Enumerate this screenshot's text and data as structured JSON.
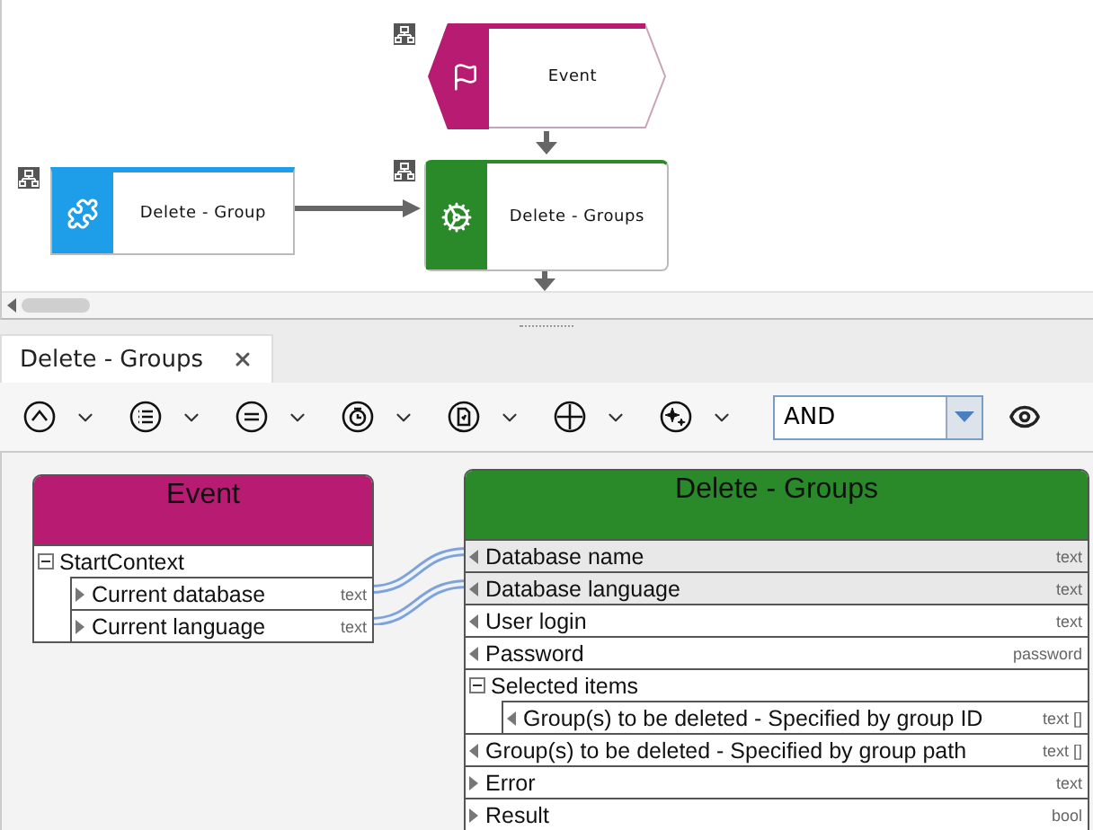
{
  "diagram": {
    "nodes": [
      {
        "kind": "event",
        "label": "Event",
        "color": "#b81c72"
      },
      {
        "kind": "function",
        "label": "Delete - Group",
        "color": "#1e9de8"
      },
      {
        "kind": "function",
        "label": "Delete - Groups",
        "color": "#2a8a2a"
      }
    ]
  },
  "tabs": [
    {
      "label": "Delete - Groups",
      "selected": true
    }
  ],
  "toolbar": {
    "operator": "AND"
  },
  "mapping": {
    "source": {
      "title": "Event",
      "color": "#b81c72",
      "rows": [
        {
          "kind": "group",
          "label": "StartContext",
          "expanded": true,
          "children": [
            {
              "kind": "output",
              "label": "Current database",
              "type": "text"
            },
            {
              "kind": "output",
              "label": "Current language",
              "type": "text"
            }
          ]
        }
      ]
    },
    "target": {
      "title": "Delete - Groups",
      "color": "#2a8a2a",
      "rows": [
        {
          "kind": "input",
          "label": "Database name",
          "type": "text",
          "mapped": true
        },
        {
          "kind": "input",
          "label": "Database language",
          "type": "text",
          "mapped": true
        },
        {
          "kind": "input",
          "label": "User login",
          "type": "text",
          "mapped": false
        },
        {
          "kind": "input",
          "label": "Password",
          "type": "password",
          "mapped": false
        },
        {
          "kind": "group",
          "label": "Selected items",
          "expanded": true,
          "children": [
            {
              "kind": "input",
              "label": "Group(s) to be deleted - Specified by group ID",
              "type": "text []",
              "mapped": false
            }
          ]
        },
        {
          "kind": "input",
          "label": "Group(s) to be deleted - Specified by group path",
          "type": "text []",
          "mapped": false
        },
        {
          "kind": "output",
          "label": "Error",
          "type": "text",
          "mapped": false
        },
        {
          "kind": "output",
          "label": "Result",
          "type": "bool",
          "mapped": false
        }
      ]
    }
  }
}
